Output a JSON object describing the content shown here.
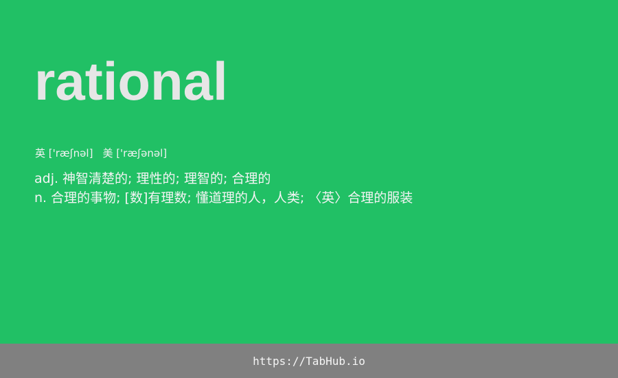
{
  "word": "rational",
  "phonetics": {
    "uk": "英 ['ræʃnəl]",
    "us": "美 ['ræʃənəl]"
  },
  "definitions": [
    "adj. 神智清楚的; 理性的; 理智的; 合理的",
    "n. 合理的事物; [数]有理数; 懂道理的人，人类; 〈英〉合理的服装"
  ],
  "footer": {
    "link": "https://TabHub.io"
  },
  "colors": {
    "background": "#21c065",
    "footer": "#808080",
    "word": "#e6e6e6"
  }
}
